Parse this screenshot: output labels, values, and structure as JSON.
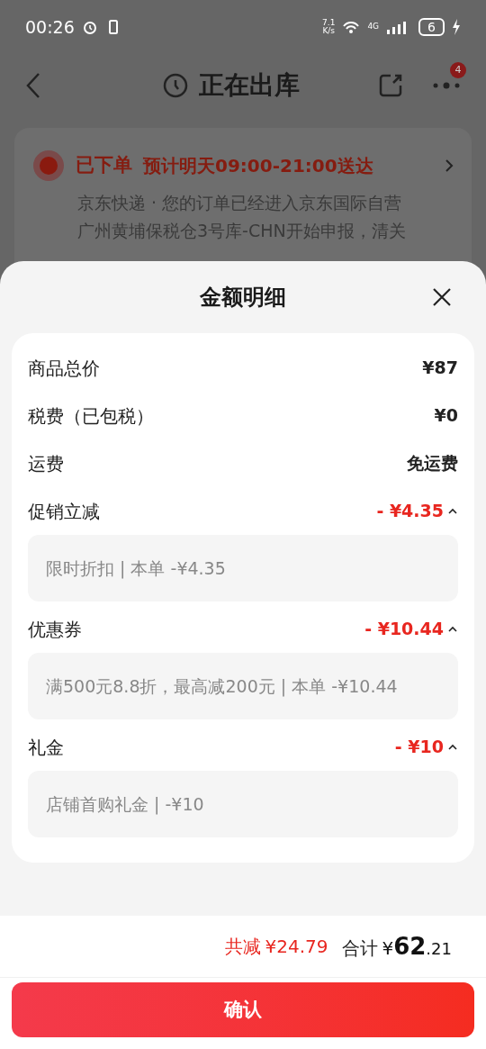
{
  "status_bar": {
    "time": "00:26",
    "speed_value": "7.1",
    "speed_unit": "K/s",
    "network": "4G",
    "battery": "6"
  },
  "header": {
    "title": "正在出库",
    "badge": "4"
  },
  "tracking": {
    "headline": "已下单",
    "eta": "预计明天09:00-21:00送达",
    "lines": [
      "京东快递 · 您的订单已经进入京东国际自营",
      "广州黄埔保税仓3号库-CHN开始申报，清关"
    ]
  },
  "sheet": {
    "title": "金额明细",
    "rows": [
      {
        "kind": "plain",
        "label": "商品总价",
        "value": "¥87"
      },
      {
        "kind": "plain",
        "label": "税费（已包税）",
        "value": "¥0"
      },
      {
        "kind": "plain",
        "label": "运费",
        "value": "免运费"
      },
      {
        "kind": "discount",
        "label": "促销立减",
        "value": "- ¥4.35",
        "expanded": true,
        "detail": "限时折扣 | 本单 -¥4.35"
      },
      {
        "kind": "discount",
        "label": "优惠券",
        "value": "- ¥10.44",
        "expanded": true,
        "detail": "满500元8.8折，最高减200元 | 本单 -¥10.44"
      },
      {
        "kind": "discount",
        "label": "礼金",
        "value": "- ¥10",
        "expanded": true,
        "detail": "店铺首购礼金 | -¥10"
      }
    ],
    "saved_label": "共减",
    "saved_value": "¥24.79",
    "total_label": "合计",
    "total_currency": "¥",
    "total_integer": "62",
    "total_decimal": ".21",
    "confirm": "确认"
  }
}
